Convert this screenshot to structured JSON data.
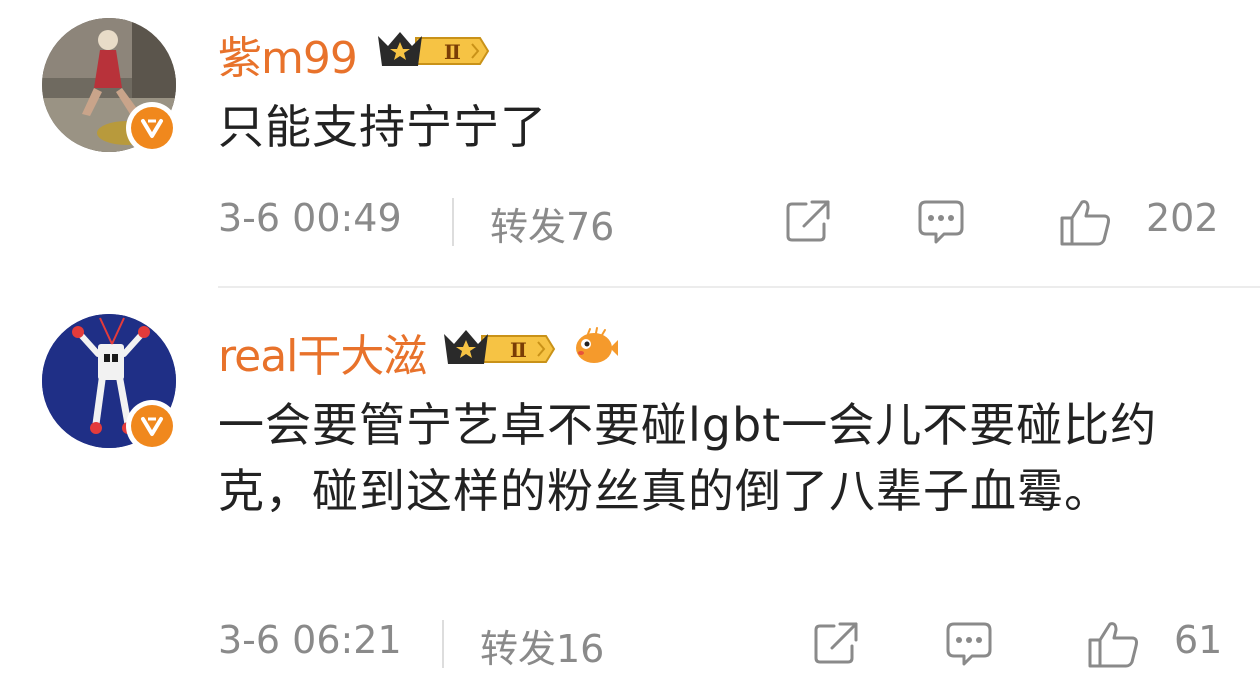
{
  "comments": [
    {
      "username": "紫m99",
      "level_badge": "Ⅱ",
      "content": "只能支持宁宁了",
      "time": "3-6 00:49",
      "repost": "转发76",
      "likes": "202",
      "icons": [
        "avatar",
        "verified-icon",
        "crown-level-badge",
        "share-icon",
        "comment-icon",
        "like-icon"
      ]
    },
    {
      "username": "real干大滋",
      "level_badge": "Ⅱ",
      "content": "一会要管宁艺卓不要碰lgbt一会儿不要碰比约克，碰到这样的粉丝真的倒了八辈子血霉。",
      "time": "3-6 06:21",
      "repost": "转发16",
      "likes": "61",
      "icons": [
        "avatar",
        "verified-icon",
        "crown-level-badge",
        "pufferfish-icon",
        "share-icon",
        "comment-icon",
        "like-icon"
      ]
    }
  ],
  "colors": {
    "username": "#e8722b",
    "meta": "#8a8a8a",
    "text": "#222222",
    "verified": "#f0881d"
  }
}
